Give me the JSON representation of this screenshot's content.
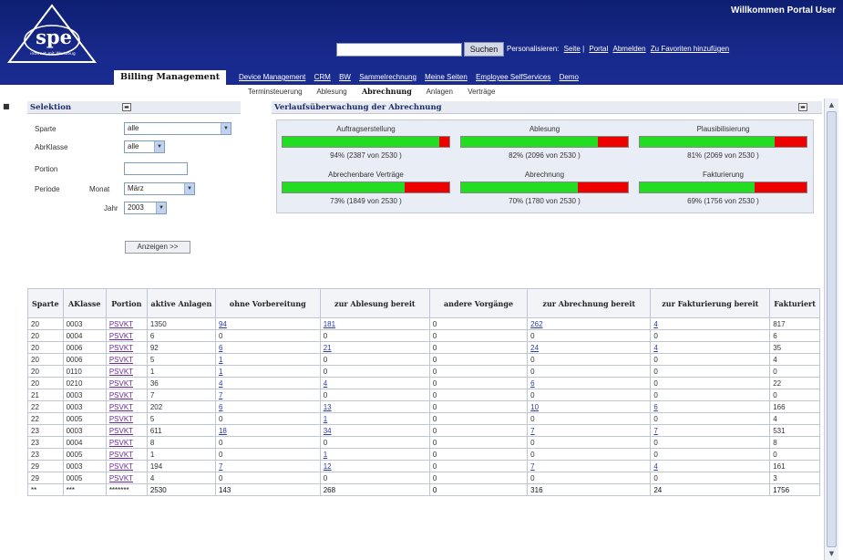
{
  "header": {
    "logo": "spe",
    "logo_subtitle": "internet mit Wertzeug",
    "welcome": "Willkommen Portal User",
    "search_button": "Suchen",
    "search_value": "",
    "personalize_label": "Personalisieren:",
    "links": [
      "Seite",
      "Portal",
      "Abmelden",
      "Zu Favoriten hinzufügen"
    ]
  },
  "topnav": {
    "active": "Billing Management",
    "items": [
      "Device Management",
      "CRM",
      "BW",
      "Sammelrechnung",
      "Meine Seiten",
      "Employee SelfServices",
      "Demo"
    ]
  },
  "subnav": {
    "items": [
      "Terminsteuerung",
      "Ablesung",
      "Abrechnung",
      "Anlagen",
      "Verträge"
    ],
    "active_index": 2
  },
  "selection": {
    "title": "Selektion",
    "fields": {
      "sparte_label": "Sparte",
      "sparte_value": "alle",
      "abrklasse_label": "AbrKlasse",
      "abrklasse_value": "alle",
      "portion_label": "Portion",
      "portion_value": "",
      "periode_label": "Periode",
      "monat_label": "Monat",
      "monat_value": "März",
      "jahr_label": "Jahr",
      "jahr_value": "2003"
    },
    "show_button": "Anzeigen >>"
  },
  "monitor": {
    "title": "Verlaufsüberwachung der Abrechnung",
    "cards": [
      {
        "title": "Auftragserstellung",
        "percent": 94,
        "text": "94% (2387 von 2530 )"
      },
      {
        "title": "Ablesung",
        "percent": 82,
        "text": "82% (2096 von 2530 )"
      },
      {
        "title": "Plausibilisierung",
        "percent": 81,
        "text": "81% (2069 von 2530 )"
      },
      {
        "title": "Abrechenbare Verträge",
        "percent": 73,
        "text": "73% (1849 von 2530 )"
      },
      {
        "title": "Abrechnung",
        "percent": 70,
        "text": "70% (1780 von 2530 )"
      },
      {
        "title": "Fakturierung",
        "percent": 69,
        "text": "69% (1756 von 2530 )"
      }
    ]
  },
  "table": {
    "headers": [
      "Sparte",
      "AKlasse",
      "Portion",
      "aktive Anlagen",
      "ohne Vorbereitung",
      "zur Ablesung bereit",
      "andere Vorgänge",
      "zur Abrechnung bereit",
      "zur Fakturierung bereit",
      "Fakturiert"
    ],
    "rows": [
      [
        "20",
        "0003",
        "PSVKT",
        "1350",
        "94",
        "181",
        "0",
        "262",
        "4",
        "817"
      ],
      [
        "20",
        "0004",
        "PSVKT",
        "6",
        "0",
        "0",
        "0",
        "0",
        "0",
        "6"
      ],
      [
        "20",
        "0006",
        "PSVKT",
        "92",
        "6",
        "21",
        "0",
        "24",
        "4",
        "35"
      ],
      [
        "20",
        "0006",
        "PSVKT",
        "5",
        "1",
        "0",
        "0",
        "0",
        "0",
        "4"
      ],
      [
        "20",
        "0110",
        "PSVKT",
        "1",
        "1",
        "0",
        "0",
        "0",
        "0",
        "0"
      ],
      [
        "20",
        "0210",
        "PSVKT",
        "36",
        "4",
        "4",
        "0",
        "6",
        "0",
        "22"
      ],
      [
        "21",
        "0003",
        "PSVKT",
        "7",
        "7",
        "0",
        "0",
        "0",
        "0",
        "0"
      ],
      [
        "22",
        "0003",
        "PSVKT",
        "202",
        "6",
        "13",
        "0",
        "10",
        "6",
        "166"
      ],
      [
        "22",
        "0005",
        "PSVKT",
        "5",
        "0",
        "1",
        "0",
        "0",
        "0",
        "4"
      ],
      [
        "23",
        "0003",
        "PSVKT",
        "611",
        "18",
        "34",
        "0",
        "7",
        "7",
        "531"
      ],
      [
        "23",
        "0004",
        "PSVKT",
        "8",
        "0",
        "0",
        "0",
        "0",
        "0",
        "8"
      ],
      [
        "23",
        "0005",
        "PSVKT",
        "1",
        "0",
        "1",
        "0",
        "0",
        "0",
        "0"
      ],
      [
        "29",
        "0003",
        "PSVKT",
        "194",
        "7",
        "12",
        "0",
        "7",
        "4",
        "161"
      ],
      [
        "29",
        "0005",
        "PSVKT",
        "4",
        "0",
        "0",
        "0",
        "0",
        "0",
        "3"
      ],
      [
        "**",
        "***",
        "*******",
        "2530",
        "143",
        "268",
        "0",
        "316",
        "24",
        "1756"
      ]
    ],
    "link_columns": [
      4,
      5,
      7,
      8
    ]
  }
}
